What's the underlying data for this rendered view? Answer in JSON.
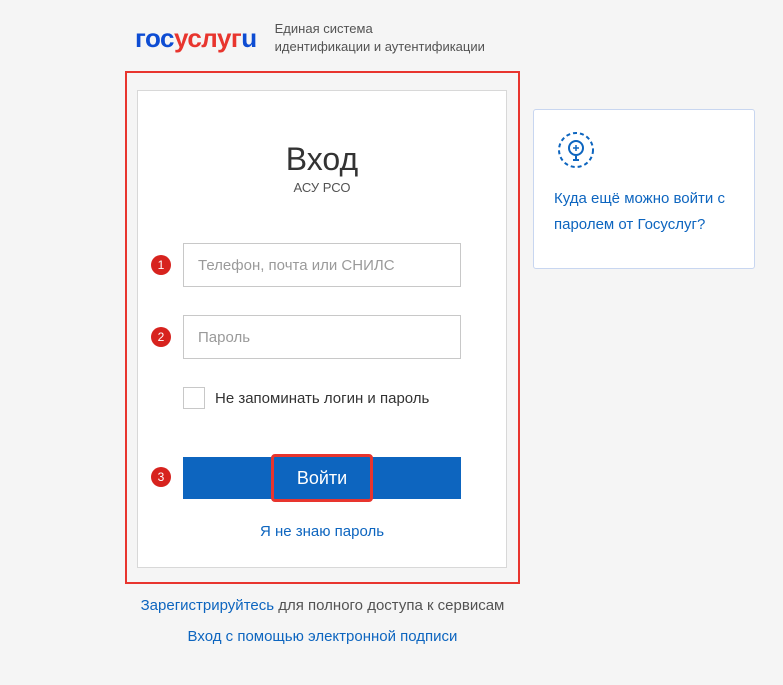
{
  "header": {
    "logo_gos": "гос",
    "logo_uslugi": "услуг",
    "logo_i": "u",
    "tagline_line1": "Единая система",
    "tagline_line2": "идентификации и аутентификации"
  },
  "login": {
    "title": "Вход",
    "subtitle": "АСУ РСО",
    "login_placeholder": "Телефон, почта или СНИЛС",
    "password_placeholder": "Пароль",
    "checkbox_label": "Не запоминать логин и пароль",
    "button_label": "Войти",
    "forgot_label": "Я не знаю пароль"
  },
  "badges": {
    "b1": "1",
    "b2": "2",
    "b3": "3"
  },
  "sidebar": {
    "link_text": "Куда ещё можно войти с паролем от Госуслуг?"
  },
  "footer": {
    "register_link": "Зарегистрируйтесь",
    "register_rest": " для полного доступа к сервисам",
    "signature_link": "Вход с помощью электронной подписи"
  }
}
